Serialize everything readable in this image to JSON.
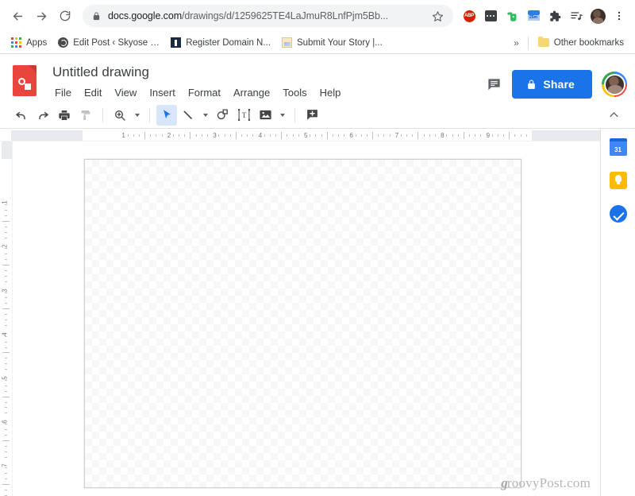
{
  "browser": {
    "nav": {
      "back": "back-arrow",
      "forward": "forward-arrow",
      "reload": "reload"
    },
    "omnibox": {
      "lock_icon": "lock-icon",
      "url_domain": "docs.google.com",
      "url_path": "/drawings/d/1259625TE4LaJmuR8LnfPjm5Bb...",
      "bookmark_icon": "star-icon"
    },
    "extensions": [
      {
        "name": "adblock-plus-extension",
        "label": "ABP"
      },
      {
        "name": "dots-extension",
        "label": ""
      },
      {
        "name": "evernote-extension",
        "label": ""
      },
      {
        "name": "blue-extension",
        "label": "25m"
      },
      {
        "name": "extensions-puzzle-icon",
        "label": ""
      },
      {
        "name": "media-playlist-icon",
        "label": ""
      }
    ],
    "profile_avatar": "profile-avatar",
    "menu_icon": "three-dot-menu-icon",
    "bookmarks": [
      {
        "label": "Apps",
        "icon": "apps-grid-icon"
      },
      {
        "label": "Edit Post ‹ Skyose -...",
        "icon": "globe-icon"
      },
      {
        "label": "Register Domain N...",
        "icon": "square-icon"
      },
      {
        "label": "Submit Your Story |...",
        "icon": "page-icon"
      }
    ],
    "overflow_label": "»",
    "other_bookmarks": {
      "label": "Other bookmarks",
      "icon": "folder-icon"
    }
  },
  "app": {
    "logo": "google-drawings-logo",
    "title": "Untitled drawing",
    "menus": [
      "File",
      "Edit",
      "View",
      "Insert",
      "Format",
      "Arrange",
      "Tools",
      "Help"
    ],
    "comment_icon": "comment-icon",
    "share": {
      "label": "Share",
      "icon": "lock-icon",
      "color": "#1a73e8"
    },
    "account_avatar": "account-avatar",
    "toolbar": [
      {
        "name": "undo-button",
        "icon": "undo-icon",
        "state": "enabled"
      },
      {
        "name": "redo-button",
        "icon": "redo-icon",
        "state": "enabled"
      },
      {
        "name": "print-button",
        "icon": "print-icon",
        "state": "enabled"
      },
      {
        "name": "paint-format-button",
        "icon": "paint-format-icon",
        "state": "disabled"
      },
      {
        "name": "zoom-button",
        "icon": "zoom-in-icon",
        "state": "enabled",
        "dropdown": true
      },
      {
        "name": "select-tool-button",
        "icon": "cursor-arrow-icon",
        "state": "active"
      },
      {
        "name": "line-tool-button",
        "icon": "line-icon",
        "state": "enabled",
        "dropdown": true
      },
      {
        "name": "shape-tool-button",
        "icon": "shape-icon",
        "state": "enabled"
      },
      {
        "name": "text-box-button",
        "icon": "text-box-icon",
        "state": "enabled"
      },
      {
        "name": "image-button",
        "icon": "image-icon",
        "state": "enabled",
        "dropdown": true
      },
      {
        "name": "comment-add-button",
        "icon": "add-comment-icon",
        "state": "enabled"
      }
    ],
    "collapse_icon": "chevron-up-icon",
    "ruler_horizontal": [
      "1",
      "2",
      "3",
      "4",
      "5",
      "6",
      "7",
      "8",
      "9"
    ],
    "ruler_vertical": [
      "1",
      "2",
      "3",
      "4",
      "5",
      "6",
      "7"
    ],
    "canvas": {
      "name": "drawing-canvas",
      "background": "transparent-checkerboard"
    },
    "watermark": {
      "prefix": "g",
      "text": "roovyPost.com"
    },
    "side_panel": [
      {
        "name": "google-calendar-icon",
        "label": "31"
      },
      {
        "name": "google-keep-icon",
        "label": ""
      },
      {
        "name": "google-tasks-icon",
        "label": ""
      }
    ]
  }
}
